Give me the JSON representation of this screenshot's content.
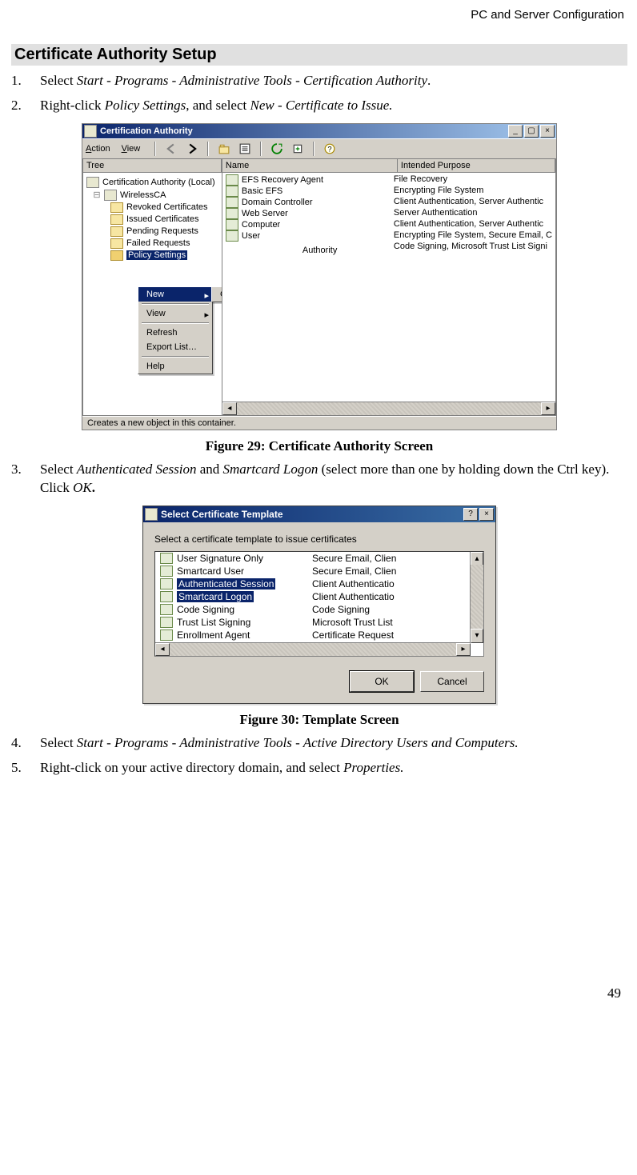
{
  "header": {
    "section": "PC and Server Configuration"
  },
  "heading": "Certificate Authority Setup",
  "steps": {
    "s1": {
      "pre": "Select ",
      "path": "Start - Programs - Administrative Tools - Certification Authority",
      "post": "."
    },
    "s2": {
      "pre": "Right-click ",
      "a": "Policy Settings",
      "mid": ", and select ",
      "b": "New - Certificate to Issue.",
      "post": ""
    },
    "s3": {
      "pre": "Select ",
      "a": "Authenticated Session",
      "mid1": " and ",
      "b": "Smartcard Logon",
      "mid2": " (select more than one by holding down the Ctrl key). Click ",
      "c": "OK",
      "post": "."
    },
    "s4": {
      "pre": "Select ",
      "path": "Start - Programs - Administrative Tools - Active Directory Users and Computers.",
      "post": ""
    },
    "s5": {
      "pre": "Right-click on your active directory domain, and select ",
      "a": "Properties.",
      "post": ""
    }
  },
  "fig29": {
    "caption": "Figure 29: Certificate Authority Screen",
    "title": "Certification Authority",
    "menu": {
      "action": "Action",
      "view": "View"
    },
    "treeHeader": "Tree",
    "cols": {
      "name": "Name",
      "purpose": "Intended Purpose"
    },
    "tree": {
      "root": "Certification Authority (Local)",
      "ca": "WirelessCA",
      "items": [
        "Revoked Certificates",
        "Issued Certificates",
        "Pending Requests",
        "Failed Requests",
        "Policy Settings"
      ]
    },
    "list": [
      {
        "name": "EFS Recovery Agent",
        "purpose": "File Recovery"
      },
      {
        "name": "Basic EFS",
        "purpose": "Encrypting File System"
      },
      {
        "name": "Domain Controller",
        "purpose": "Client Authentication, Server Authentic"
      },
      {
        "name": "Web Server",
        "purpose": "Server Authentication"
      },
      {
        "name": "Computer",
        "purpose": "Client Authentication, Server Authentic"
      },
      {
        "name": "User",
        "purpose": "Encrypting File System, Secure Email, C"
      },
      {
        "name": "",
        "purpose": ""
      },
      {
        "name": "",
        "purpose": "Code Signing, Microsoft Trust List Signi"
      }
    ],
    "ctx": {
      "new": "New",
      "view": "View",
      "refresh": "Refresh",
      "export": "Export List…",
      "help": "Help",
      "sub": "Certificate to Issue"
    },
    "authorityFragment": "Authority",
    "status": "Creates a new object in this container."
  },
  "fig30": {
    "caption": "Figure 30: Template Screen",
    "title": "Select Certificate Template",
    "prompt": "Select a certificate template to issue certificates",
    "rows": [
      {
        "name": "User Signature Only",
        "purpose": "Secure Email, Clien",
        "sel": false
      },
      {
        "name": "Smartcard User",
        "purpose": "Secure Email, Clien",
        "sel": false
      },
      {
        "name": "Authenticated Session",
        "purpose": "Client Authenticatio",
        "sel": true
      },
      {
        "name": "Smartcard Logon",
        "purpose": "Client Authenticatio",
        "sel": true
      },
      {
        "name": "Code Signing",
        "purpose": "Code Signing",
        "sel": false
      },
      {
        "name": "Trust List Signing",
        "purpose": "Microsoft Trust List",
        "sel": false
      },
      {
        "name": "Enrollment Agent",
        "purpose": "Certificate Request",
        "sel": false
      }
    ],
    "buttons": {
      "ok": "OK",
      "cancel": "Cancel"
    }
  },
  "pageNumber": "49"
}
